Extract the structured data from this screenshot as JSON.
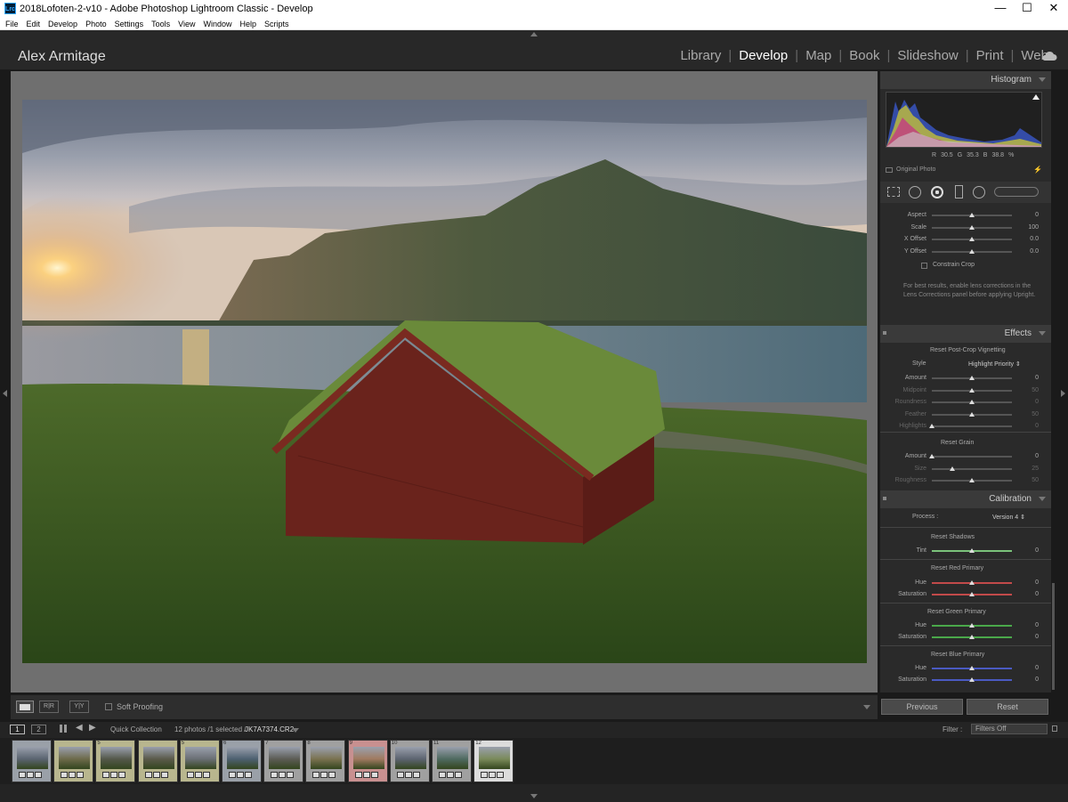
{
  "window": {
    "title": "2018Lofoten-2-v10 - Adobe Photoshop Lightroom Classic - Develop",
    "app_icon": "Lrc",
    "controls": [
      "—",
      "☐",
      "✕"
    ]
  },
  "menu": [
    "File",
    "Edit",
    "Develop",
    "Photo",
    "Settings",
    "Tools",
    "View",
    "Window",
    "Help",
    "Scripts"
  ],
  "identity_plate": "Alex Armitage",
  "modules": [
    "Library",
    "Develop",
    "Map",
    "Book",
    "Slideshow",
    "Print",
    "Web"
  ],
  "active_module": "Develop",
  "histogram": {
    "title": "Histogram",
    "readout": {
      "r_label": "R",
      "r": "30.5",
      "g_label": "G",
      "g": "35.3",
      "b_label": "B",
      "b": "38.8",
      "unit": "%"
    },
    "original_photo": "Original Photo"
  },
  "transform": {
    "sliders": [
      {
        "label": "Aspect",
        "value": "0",
        "pos": 0.5
      },
      {
        "label": "Scale",
        "value": "100",
        "pos": 0.5
      },
      {
        "label": "X Offset",
        "value": "0.0",
        "pos": 0.5
      },
      {
        "label": "Y Offset",
        "value": "0.0",
        "pos": 0.5
      }
    ],
    "constrain_crop": "Constrain Crop",
    "note": "For best results, enable lens corrections in the Lens Corrections panel before applying Upright."
  },
  "effects": {
    "title": "Effects",
    "vignette_header": "Reset Post-Crop Vignetting",
    "style_label": "Style",
    "style_value": "Highlight Priority",
    "vignette_sliders": [
      {
        "label": "Amount",
        "value": "0",
        "pos": 0.5,
        "dim": false
      },
      {
        "label": "Midpoint",
        "value": "50",
        "pos": 0.5,
        "dim": true
      },
      {
        "label": "Roundness",
        "value": "0",
        "pos": 0.5,
        "dim": true
      },
      {
        "label": "Feather",
        "value": "50",
        "pos": 0.5,
        "dim": true
      },
      {
        "label": "Highlights",
        "value": "0",
        "pos": 0.0,
        "dim": true
      }
    ],
    "grain_header": "Reset Grain",
    "grain_sliders": [
      {
        "label": "Amount",
        "value": "0",
        "pos": 0.0,
        "dim": false
      },
      {
        "label": "Size",
        "value": "25",
        "pos": 0.25,
        "dim": true
      },
      {
        "label": "Roughness",
        "value": "50",
        "pos": 0.5,
        "dim": true
      }
    ]
  },
  "calibration": {
    "title": "Calibration",
    "process_label": "Process :",
    "process_value": "Version 4",
    "shadows_header": "Reset Shadows",
    "tint_label": "Tint",
    "tint_value": "0",
    "red_header": "Reset Red Primary",
    "green_header": "Reset Green Primary",
    "blue_header": "Reset Blue Primary",
    "hue_label": "Hue",
    "saturation_label": "Saturation",
    "zero": "0",
    "colors": {
      "red": "#c24a4a",
      "green": "#4aa84a",
      "blue": "#4a5ac2",
      "tint": "#7ac27a"
    }
  },
  "buttons": {
    "previous": "Previous",
    "reset": "Reset"
  },
  "toolbar": {
    "soft_proofing": "Soft Proofing",
    "yy": "Y|Y",
    "rr": "R|R"
  },
  "filmstrip": {
    "page1": "1",
    "page2": "2",
    "source_label": "Quick Collection",
    "count": "12 photos /1 selected /",
    "filename": "JK7A7374.CR2",
    "filter_label": "Filter :",
    "filter_value": "Filters Off",
    "thumbs": [
      {
        "num": "",
        "frame": "#9aa0a8"
      },
      {
        "num": "",
        "frame": "#b8b68e"
      },
      {
        "num": "5",
        "frame": "#b8b68e"
      },
      {
        "num": "",
        "frame": "#b8b68e"
      },
      {
        "num": "5",
        "frame": "#b8b68e"
      },
      {
        "num": "6",
        "frame": "#9aa0a8"
      },
      {
        "num": "7",
        "frame": "#a0a0a0"
      },
      {
        "num": "8",
        "frame": "#a0a0a0"
      },
      {
        "num": "9",
        "frame": "#c89090"
      },
      {
        "num": "10",
        "frame": "#a0a0a0"
      },
      {
        "num": "11",
        "frame": "#a0a0a0"
      },
      {
        "num": "12",
        "frame": "#dcdcdc"
      }
    ]
  }
}
